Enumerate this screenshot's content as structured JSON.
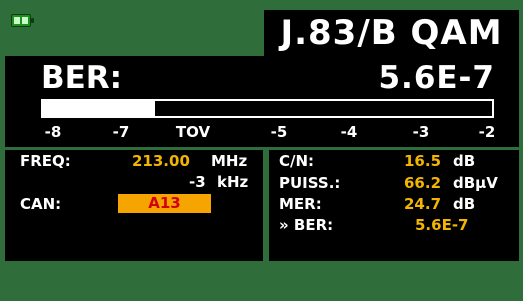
{
  "header": {
    "title": "J.83/B QAM",
    "battery_icon": "battery-icon"
  },
  "ber": {
    "label": "BER:",
    "value": "5.6E-7",
    "bar_fraction": 0.25,
    "scale": [
      "-8",
      "-7",
      "TOV",
      "-5",
      "-4",
      "-3",
      "-2"
    ]
  },
  "tuning": {
    "freq_label": "FREQ:",
    "freq_value": "213.00",
    "freq_unit": "MHz",
    "offset_value": "-3",
    "offset_unit": "kHz",
    "channel_label": "CAN:",
    "channel_value": "A13"
  },
  "measurements": {
    "cn_label": "C/N:",
    "cn_value": "16.5",
    "cn_unit": "dB",
    "power_label": "PUISS.:",
    "power_value": "66.2",
    "power_unit": "dBµV",
    "mer_label": "MER:",
    "mer_value": "24.7",
    "mer_unit": "dB",
    "ber_label": "» BER:",
    "ber_value": "5.6E-7"
  },
  "colors": {
    "background": "#2f6e3a",
    "panel": "#000000",
    "value": "#f2b600",
    "channel_box": "#f5a400",
    "channel_text": "#d4000e"
  }
}
